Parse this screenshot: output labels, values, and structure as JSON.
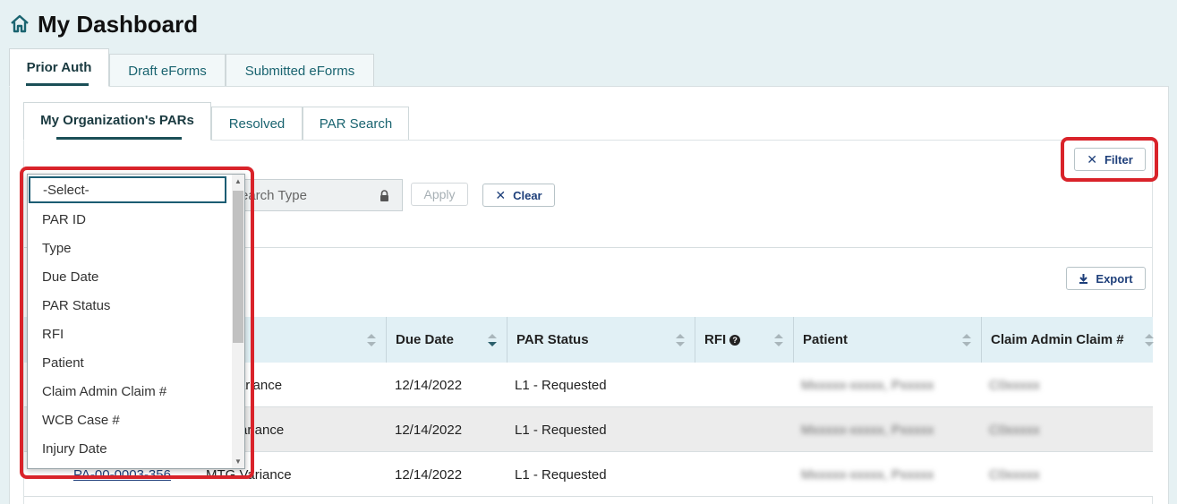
{
  "page": {
    "title": "My Dashboard"
  },
  "tabs": [
    {
      "label": "Prior Auth",
      "active": true
    },
    {
      "label": "Draft eForms",
      "active": false
    },
    {
      "label": "Submitted eForms",
      "active": false
    }
  ],
  "sub_tabs": [
    {
      "label": "My Organization's PARs",
      "active": true
    },
    {
      "label": "Resolved",
      "active": false
    },
    {
      "label": "PAR Search",
      "active": false
    }
  ],
  "toolbar": {
    "filter_label": "Filter",
    "search_type_value": "earch Type",
    "apply_label": "Apply",
    "clear_label": "Clear",
    "export_label": "Export"
  },
  "dropdown": {
    "items": [
      "-Select-",
      "PAR ID",
      "Type",
      "Due Date",
      "PAR Status",
      "RFI",
      "Patient",
      "Claim Admin Claim #",
      "WCB Case #",
      "Injury Date"
    ],
    "selected": "-Select-"
  },
  "table": {
    "columns": [
      "Due Date",
      "PAR Status",
      "RFI",
      "Patient",
      "Claim Admin Claim #"
    ],
    "rows": [
      {
        "par_id": "",
        "type": "Variance",
        "due_date": "12/14/2022",
        "status": "L1 - Requested",
        "patient": "Mxxxxx-xxxxx, Pxxxxx",
        "claim": "C0xxxxx"
      },
      {
        "par_id": "",
        "type": "ariance",
        "due_date": "12/14/2022",
        "status": "L1 - Requested",
        "patient": "Mxxxxx-xxxxx, Pxxxxx",
        "claim": "C0xxxxx"
      },
      {
        "par_id": "PA-00-0003-356",
        "type": "MTG Variance",
        "due_date": "12/14/2022",
        "status": "L1 - Requested",
        "patient": "Mxxxxx-xxxxx, Pxxxxx",
        "claim": "C0xxxxx"
      }
    ]
  },
  "colors": {
    "accent": "#1a6470",
    "highlight": "#d9232a",
    "header_bg": "#e1f0f5",
    "page_bg": "#e6f1f3"
  }
}
